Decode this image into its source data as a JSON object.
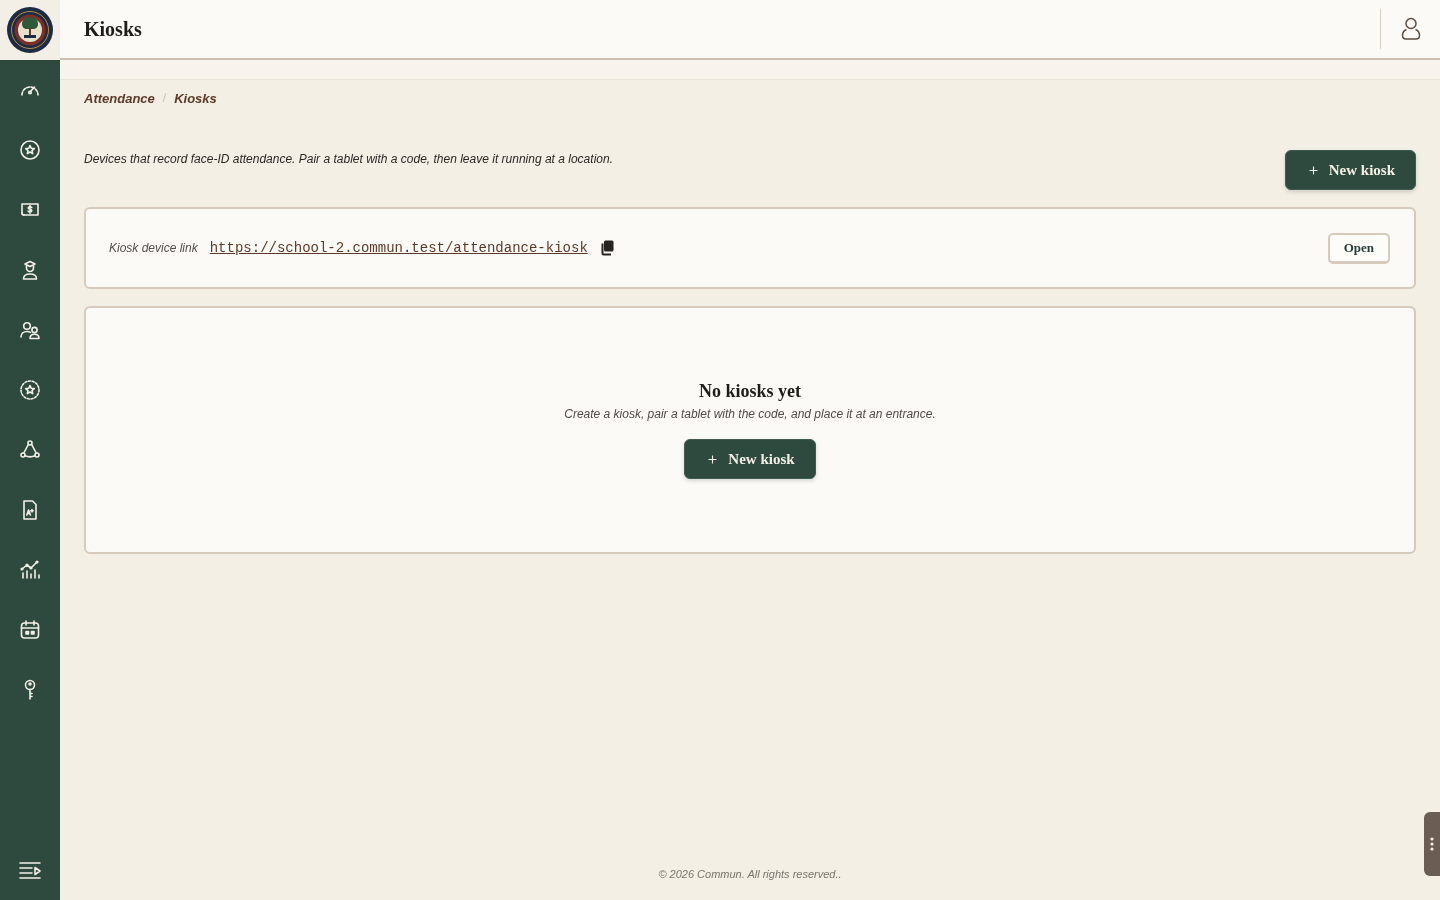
{
  "header": {
    "title": "Kiosks"
  },
  "breadcrumb": {
    "items": [
      {
        "label": "Attendance"
      },
      {
        "label": "Kiosks"
      }
    ],
    "separator": "/"
  },
  "intro": {
    "description": "Devices that record face-ID attendance. Pair a tablet with a code, then leave it running at a location.",
    "new_button": "New kiosk"
  },
  "device_link": {
    "label": "Kiosk device link",
    "url": "https://school-2.commun.test/attendance-kiosk",
    "open_button": "Open"
  },
  "empty_state": {
    "title": "No kiosks yet",
    "text": "Create a kiosk, pair a tablet with the code, and place it at an entrance.",
    "button": "New kiosk"
  },
  "footer": "© 2026 Commun. All rights reserved.."
}
